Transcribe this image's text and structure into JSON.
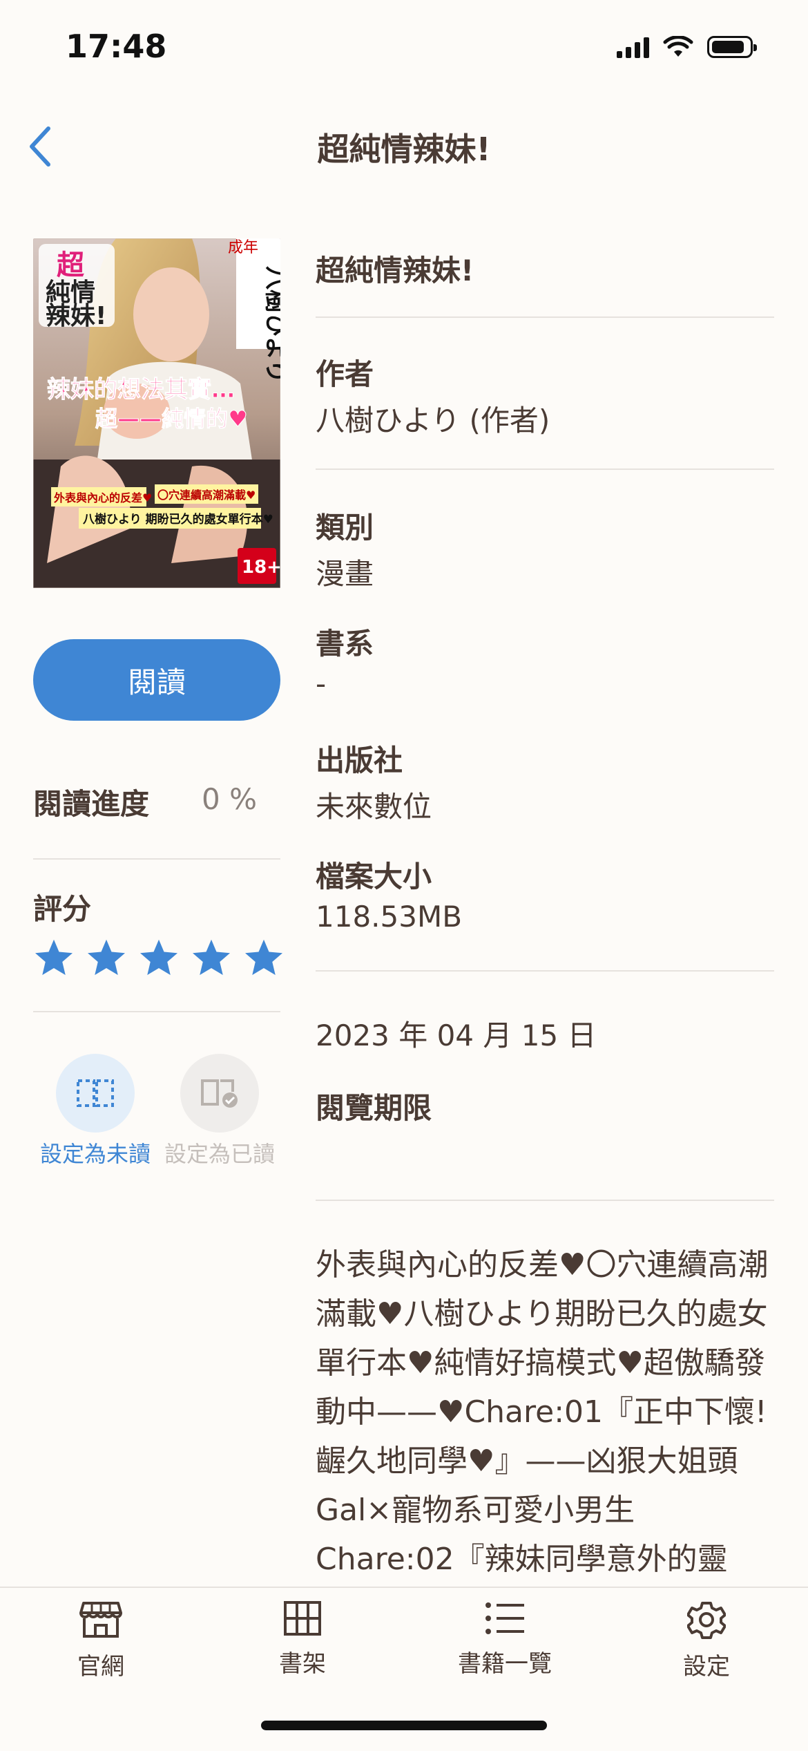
{
  "status_bar": {
    "time": "17:48"
  },
  "nav": {
    "title": "超純情辣妹!"
  },
  "book": {
    "cover_texts": {
      "rating_badge": "成年",
      "title_line1": "超",
      "title_line2": "純情",
      "title_line3": "辣妹!",
      "author": "八樹ひより",
      "headline1": "辣妹的想法其實…",
      "headline2": "超——純情的♥",
      "band1a": "外表與內心的反差♥",
      "band1b": "〇穴連續高潮滿載♥",
      "band2": "八樹ひより 期盼已久的處女單行本♥",
      "age": "18+"
    },
    "read_label": "閱讀",
    "progress_label": "閱讀進度",
    "progress_value": "0 %",
    "rating_label": "評分",
    "rating_stars": 5,
    "mark_unread": "設定為未讀",
    "mark_read": "設定為已讀",
    "title": "超純情辣妹!",
    "author_label": "作者",
    "author_value": "八樹ひより (作者)",
    "category_label": "類別",
    "category_value": "漫畫",
    "series_label": "書系",
    "series_value": "-",
    "publisher_label": "出版社",
    "publisher_value": "未來數位",
    "filesize_label": "檔案大小",
    "filesize_value": "118.53MB",
    "date": "2023 年 04 月 15 日",
    "expiry_label": "閱覽期限",
    "description": "外表與內心的反差♥〇穴連續高潮滿載♥八樹ひより期盼已久的處女單行本♥純情好搞模式♥超傲驕發動中——♥Chare:01『正中下懷!齷久地同學♥』——凶狠大姐頭Gal×寵物系可愛小男生 Chare:02『辣妹同學意外的靈"
  },
  "tabs": [
    {
      "label": "官網",
      "icon": "store-icon"
    },
    {
      "label": "書架",
      "icon": "grid-icon"
    },
    {
      "label": "書籍一覽",
      "icon": "list-icon"
    },
    {
      "label": "設定",
      "icon": "gear-icon"
    }
  ],
  "colors": {
    "accent": "#3f86d4",
    "text": "#4a3b34",
    "muted": "#8a817c",
    "background": "#fdfbf8"
  }
}
